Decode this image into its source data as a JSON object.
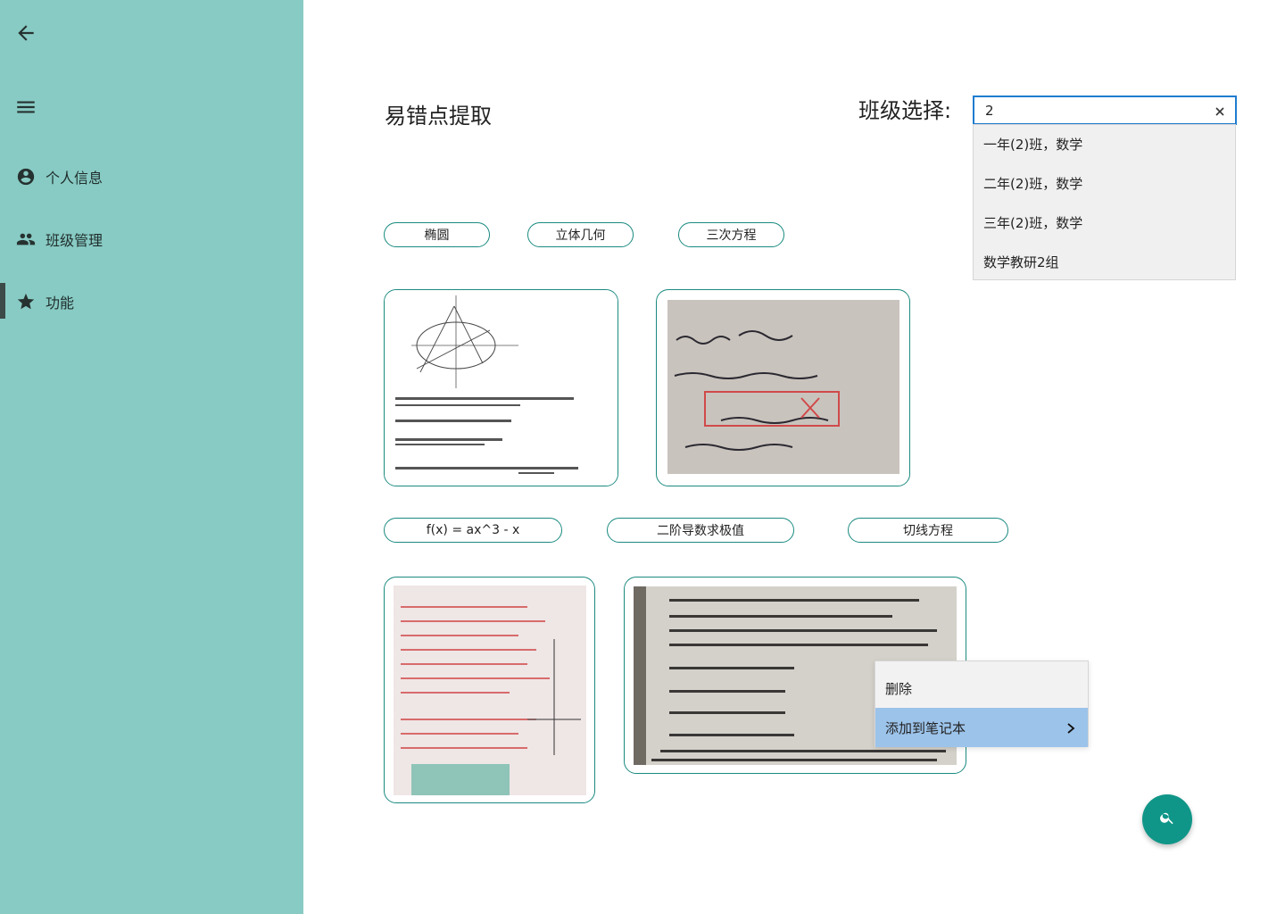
{
  "sidebar": {
    "back_icon": "arrow-back-icon",
    "menu_icon": "menu-icon",
    "items": [
      {
        "label": "个人信息",
        "icon": "account-circle-icon"
      },
      {
        "label": "班级管理",
        "icon": "people-icon"
      },
      {
        "label": "功能",
        "icon": "star-icon",
        "active": true
      }
    ],
    "bg_color": "#88cbc4"
  },
  "main": {
    "title": "易错点提取",
    "class_select": {
      "label": "班级选择:",
      "input_value": "2",
      "options": [
        "一年(2)班，数学",
        "二年(2)班，数学",
        "三年(2)班，数学",
        "数学教研2组"
      ]
    },
    "tag_rows": [
      [
        "椭圆",
        "立体几何",
        "三次方程"
      ],
      [
        "f(x) = ax^3 - x",
        "二阶导数求极值",
        "切线方程"
      ]
    ],
    "context_menu": {
      "items": [
        "删除",
        "添加到笔记本"
      ],
      "highlighted": 1
    },
    "fab_icon": "search-icon",
    "accent_color": "#0f9688"
  }
}
